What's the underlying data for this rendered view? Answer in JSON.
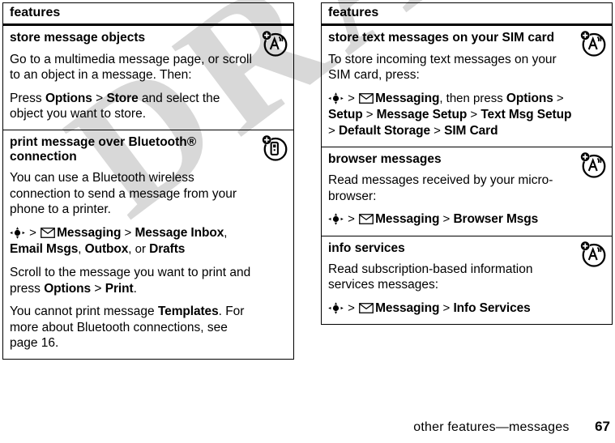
{
  "watermark": {
    "text": "DRAFT"
  },
  "footer": {
    "title": "other features—messages",
    "page_number": "67"
  },
  "columns": [
    {
      "header": "features",
      "rows": [
        {
          "icon": "network-antenna-icon",
          "heading": "store message objects",
          "blocks": [
            {
              "type": "text",
              "text": "Go to a multimedia message page, or scroll to an object in a message. Then:"
            },
            {
              "type": "rich",
              "parts": [
                {
                  "t": "Press ",
                  "b": false
                },
                {
                  "t": "Options",
                  "b": true
                },
                {
                  "t": " > ",
                  "b": false
                },
                {
                  "t": "Store",
                  "b": true
                },
                {
                  "t": " and select the object you want to store.",
                  "b": false
                }
              ]
            }
          ]
        },
        {
          "icon": "phone-device-icon",
          "heading": "print message over Bluetooth® connection",
          "blocks": [
            {
              "type": "text",
              "text": "You can use a Bluetooth wireless connection to send a message from your phone to a printer."
            },
            {
              "type": "path",
              "parts": [
                {
                  "t": "navkey",
                  "b": false,
                  "icon": "nav-key-icon"
                },
                {
                  "t": " > ",
                  "b": false
                },
                {
                  "t": "envelope",
                  "b": false,
                  "icon": "envelope-icon"
                },
                {
                  "t": "Messaging",
                  "b": true
                },
                {
                  "t": " > ",
                  "b": false
                },
                {
                  "t": "Message Inbox",
                  "b": true
                },
                {
                  "t": ", ",
                  "b": false
                },
                {
                  "t": "Email Msgs",
                  "b": true
                },
                {
                  "t": ", ",
                  "b": false
                },
                {
                  "t": "Outbox",
                  "b": true
                },
                {
                  "t": ", or ",
                  "b": false
                },
                {
                  "t": "Drafts",
                  "b": true
                }
              ]
            },
            {
              "type": "rich",
              "parts": [
                {
                  "t": "Scroll to the message you want to print and press ",
                  "b": false
                },
                {
                  "t": "Options",
                  "b": true
                },
                {
                  "t": " > ",
                  "b": false
                },
                {
                  "t": "Print",
                  "b": true
                },
                {
                  "t": ".",
                  "b": false
                }
              ]
            },
            {
              "type": "rich",
              "parts": [
                {
                  "t": "You cannot print message ",
                  "b": false
                },
                {
                  "t": "Templates",
                  "b": true
                },
                {
                  "t": ". For more about Bluetooth connections, see page 16.",
                  "b": false
                }
              ]
            }
          ]
        }
      ]
    },
    {
      "header": "features",
      "rows": [
        {
          "icon": "network-antenna-icon",
          "heading": "store text messages on your SIM card",
          "blocks": [
            {
              "type": "text",
              "text": "To store incoming text messages on your SIM card, press:"
            },
            {
              "type": "path",
              "parts": [
                {
                  "t": "navkey",
                  "b": false,
                  "icon": "nav-key-icon"
                },
                {
                  "t": " > ",
                  "b": false
                },
                {
                  "t": "envelope",
                  "b": false,
                  "icon": "envelope-icon"
                },
                {
                  "t": "Messaging",
                  "b": true
                },
                {
                  "t": ", then press ",
                  "b": false
                },
                {
                  "t": "Options",
                  "b": true
                },
                {
                  "t": " > ",
                  "b": false
                },
                {
                  "t": "Setup",
                  "b": true
                },
                {
                  "t": " > ",
                  "b": false
                },
                {
                  "t": "Message Setup",
                  "b": true
                },
                {
                  "t": " > ",
                  "b": false
                },
                {
                  "t": "Text Msg Setup",
                  "b": true
                },
                {
                  "t": " > ",
                  "b": false
                },
                {
                  "t": "Default Storage",
                  "b": true
                },
                {
                  "t": " > ",
                  "b": false
                },
                {
                  "t": "SIM Card",
                  "b": true
                }
              ]
            }
          ]
        },
        {
          "icon": "network-antenna-icon",
          "heading": "browser messages",
          "blocks": [
            {
              "type": "text",
              "text": "Read messages received by your micro-browser:"
            },
            {
              "type": "path",
              "parts": [
                {
                  "t": "navkey",
                  "b": false,
                  "icon": "nav-key-icon"
                },
                {
                  "t": " > ",
                  "b": false
                },
                {
                  "t": "envelope",
                  "b": false,
                  "icon": "envelope-icon"
                },
                {
                  "t": "Messaging",
                  "b": true
                },
                {
                  "t": " > ",
                  "b": false
                },
                {
                  "t": "Browser Msgs",
                  "b": true
                }
              ]
            }
          ]
        },
        {
          "icon": "network-antenna-icon",
          "heading": "info services",
          "blocks": [
            {
              "type": "text",
              "text": "Read subscription-based information services messages:"
            },
            {
              "type": "path",
              "parts": [
                {
                  "t": "navkey",
                  "b": false,
                  "icon": "nav-key-icon"
                },
                {
                  "t": " > ",
                  "b": false
                },
                {
                  "t": "envelope",
                  "b": false,
                  "icon": "envelope-icon"
                },
                {
                  "t": "Messaging",
                  "b": true
                },
                {
                  "t": " > ",
                  "b": false
                },
                {
                  "t": "Info Services",
                  "b": true
                }
              ]
            }
          ]
        }
      ]
    }
  ]
}
